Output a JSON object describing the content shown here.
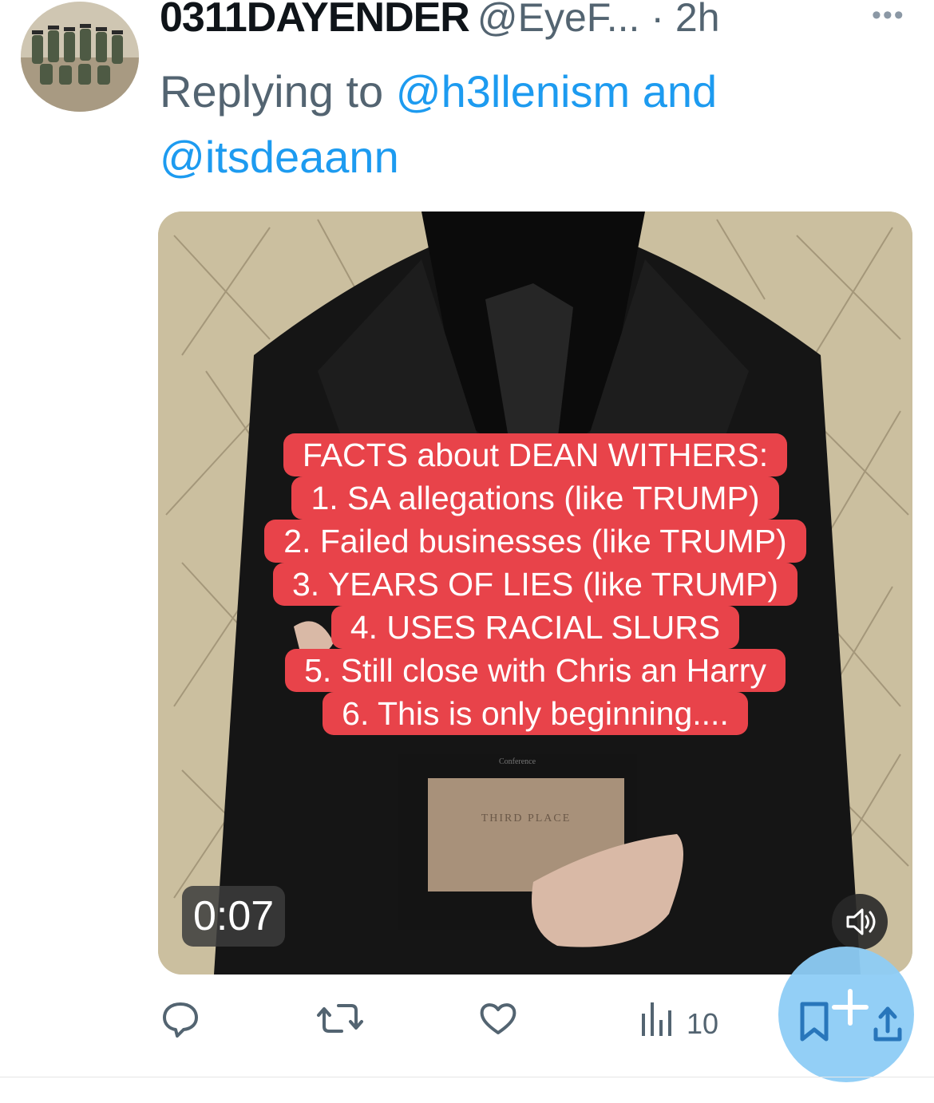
{
  "tweet": {
    "display_name": "0311DAYENDER",
    "handle_time": "@EyeF... · 2h",
    "reply_prefix": "Replying to ",
    "reply_mention_1": "@h3llenism",
    "reply_and": " and",
    "reply_mention_2": "@itsdeaann"
  },
  "media": {
    "facts": [
      "FACTS about DEAN WITHERS:",
      "1. SA allegations (like TRUMP)",
      "2. Failed businesses (like TRUMP)",
      "3. YEARS OF LIES (like TRUMP)",
      "4. USES RACIAL SLURS",
      "5. Still close with Chris an Harry",
      "6. This is only beginning...."
    ],
    "plaque_text": "THIRD PLACE",
    "plaque_top": "Conference",
    "timer": "0:07",
    "overlay_color": "#e8434a"
  },
  "actions": {
    "views": "10",
    "accent": "#1d9bf0",
    "icon_color": "#536471"
  },
  "fab": {
    "color": "#8ecdf6"
  }
}
